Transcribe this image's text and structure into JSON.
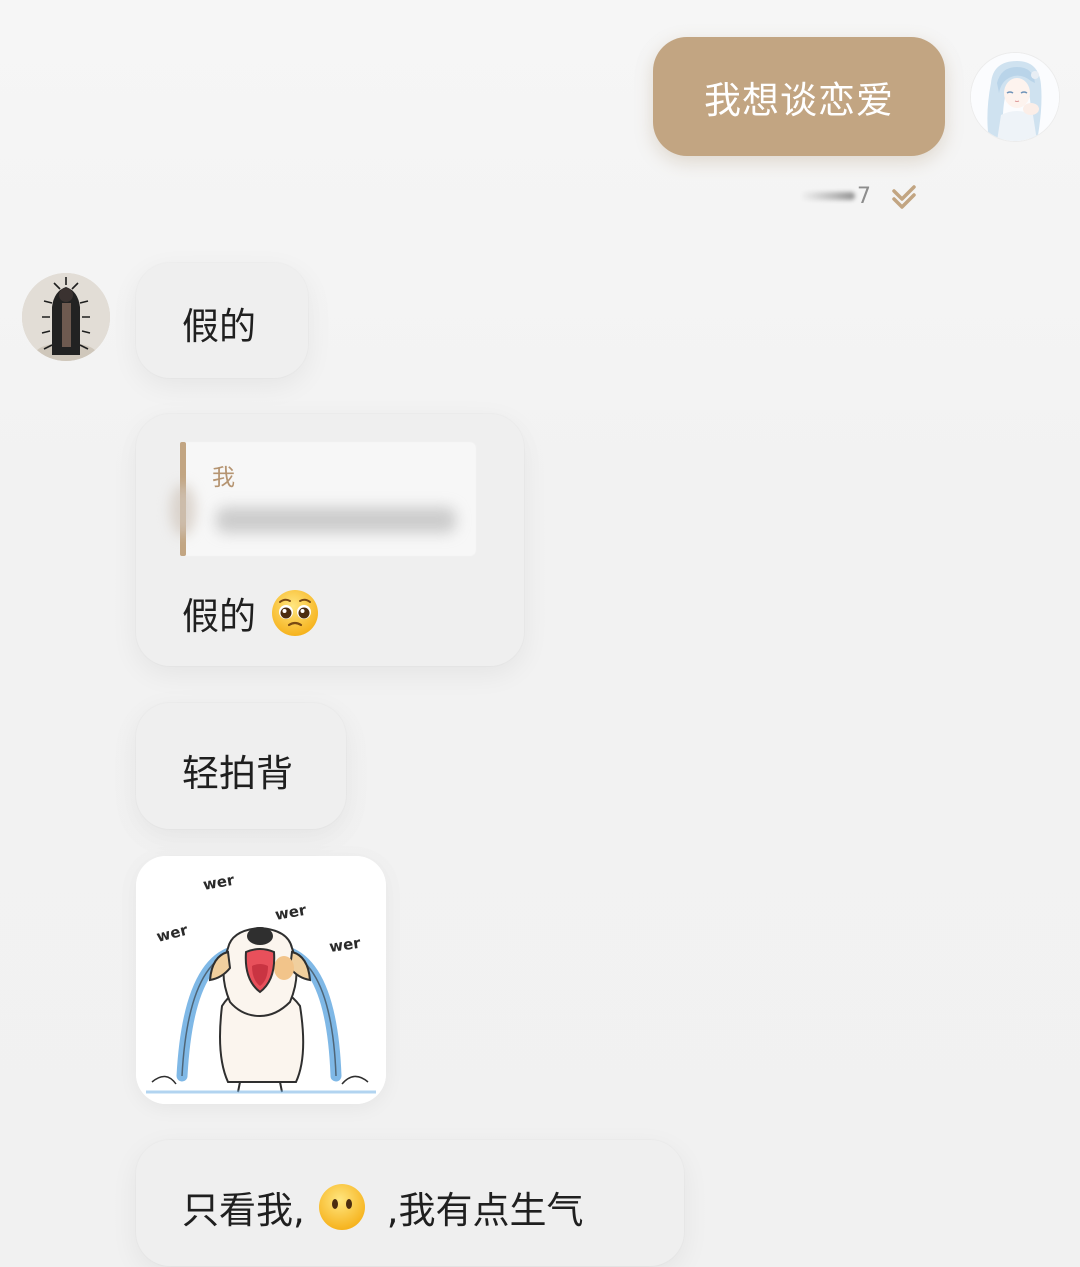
{
  "conversation": {
    "outgoing": {
      "message": "我想谈恋爱",
      "time_partial": "7",
      "status_icon": "double-check-icon",
      "bubble_color": "#c2a582"
    },
    "incoming": [
      {
        "type": "text",
        "text": "假的"
      },
      {
        "type": "reply",
        "quote_author": "我",
        "text": "假的",
        "emoji": "pleading-face"
      },
      {
        "type": "text",
        "text": "轻拍背"
      },
      {
        "type": "sticker",
        "words": [
          "wer",
          "wer",
          "wer",
          "wer"
        ]
      },
      {
        "type": "text",
        "text_before": "只看我,",
        "emoji": "face-without-mouth",
        "text_after": ",我有点生气"
      }
    ]
  }
}
